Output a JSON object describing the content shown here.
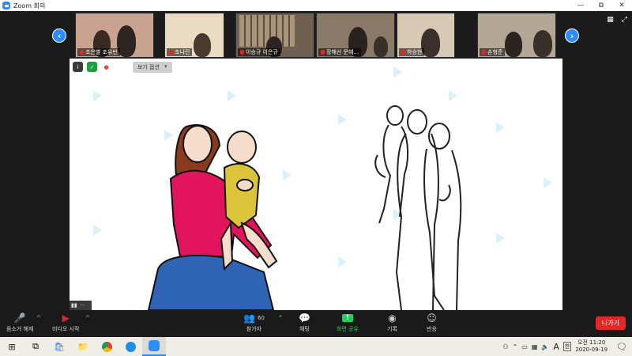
{
  "window": {
    "title": "Zoom 회의",
    "minimize": "—",
    "restore": "⧉",
    "close": "✕"
  },
  "thumbnails": [
    {
      "name": "조은별 조유빈",
      "bg": "#c9a38f"
    },
    {
      "name": "조나린",
      "bg": "#e9d9c0"
    },
    {
      "name": "이승규 이은규",
      "bg": "#7b6b5b"
    },
    {
      "name": "장해선 문혜...",
      "bg": "#8a7a68"
    },
    {
      "name": "하승현",
      "bg": "#d8c9b5"
    },
    {
      "name": "손형준",
      "bg": "#b4a796"
    }
  ],
  "share": {
    "view_button": "보기 옵션",
    "view_caret": "▾",
    "icons": {
      "info": "i",
      "shield": "✓",
      "record": "●"
    }
  },
  "controls": {
    "mute_label": "음소거 해제",
    "video_label": "비디오 시작",
    "participants_label": "참가자",
    "participants_count": "60",
    "chat_label": "채팅",
    "share_label": "화면 공유",
    "record_label": "기록",
    "reactions_label": "반응",
    "leave_label": "나가기",
    "caret": "^"
  },
  "signal": {
    "dots": "···"
  },
  "taskbar": {
    "time": "오전 11:20",
    "date": "2020-09-19",
    "ime": "A",
    "ime2": "한"
  },
  "colors": {
    "accent": "#2d8cff",
    "leave": "#e02828",
    "share_green": "#1fcf5f"
  }
}
